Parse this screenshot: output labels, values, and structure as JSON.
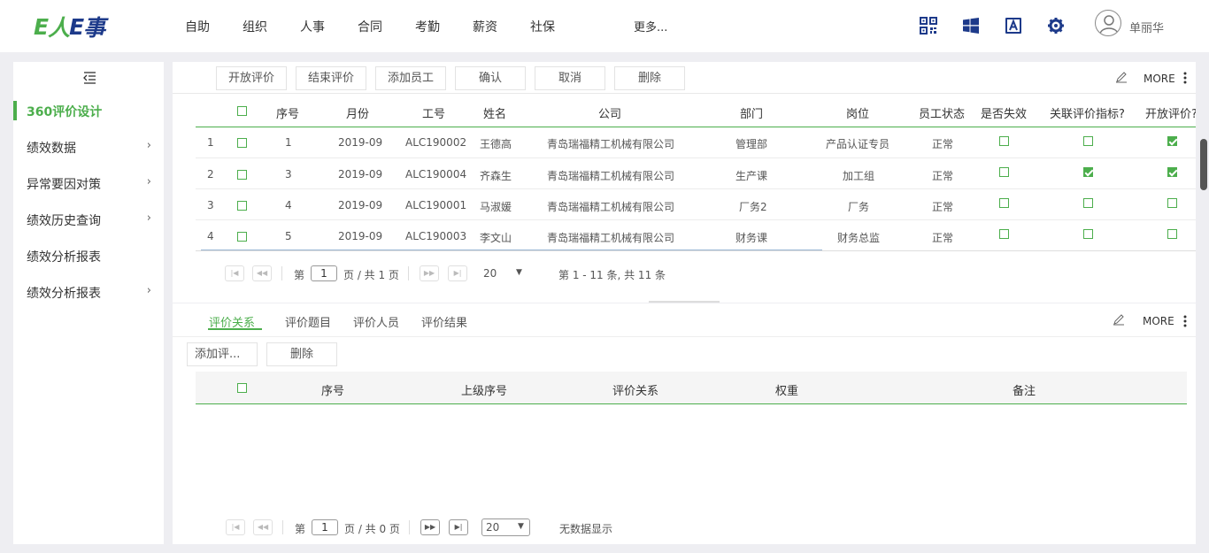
{
  "app": {
    "logo_parts": [
      "E",
      "人",
      "E",
      "事"
    ],
    "nav": [
      "自助",
      "组织",
      "人事",
      "合同",
      "考勤",
      "薪资",
      "社保"
    ],
    "nav_more": "更多...",
    "user_name": "单丽华"
  },
  "sidebar": {
    "items": [
      {
        "label": "360评价设计",
        "active": true,
        "has_children": false
      },
      {
        "label": "绩效数据",
        "active": false,
        "has_children": true
      },
      {
        "label": "异常要因对策",
        "active": false,
        "has_children": true
      },
      {
        "label": "绩效历史查询",
        "active": false,
        "has_children": true
      },
      {
        "label": "绩效分析报表",
        "active": false,
        "has_children": false
      },
      {
        "label": "绩效分析报表",
        "active": false,
        "has_children": true
      }
    ],
    "chevron": "›"
  },
  "toolbar": {
    "buttons": [
      "开放评价",
      "结束评价",
      "添加员工",
      "确认",
      "取消",
      "删除"
    ],
    "more": "MORE"
  },
  "grid": {
    "headers": [
      "序号",
      "月份",
      "工号",
      "姓名",
      "公司",
      "部门",
      "岗位",
      "员工状态",
      "是否失效",
      "关联评价指标?",
      "开放评价?"
    ],
    "rows": [
      {
        "n": "1",
        "seq": "1",
        "month": "2019-09",
        "id": "ALC190002",
        "name": "王德高",
        "company": "青岛瑞福精工机械有限公司",
        "dept": "管理部",
        "post": "产品认证专员",
        "status": "正常",
        "invalid": false,
        "linked": false,
        "open": true
      },
      {
        "n": "2",
        "seq": "3",
        "month": "2019-09",
        "id": "ALC190004",
        "name": "齐森生",
        "company": "青岛瑞福精工机械有限公司",
        "dept": "生产课",
        "post": "加工组",
        "status": "正常",
        "invalid": false,
        "linked": true,
        "open": true
      },
      {
        "n": "3",
        "seq": "4",
        "month": "2019-09",
        "id": "ALC190001",
        "name": "马淑媛",
        "company": "青岛瑞福精工机械有限公司",
        "dept": "厂务2",
        "post": "厂务",
        "status": "正常",
        "invalid": false,
        "linked": false,
        "open": false
      },
      {
        "n": "4",
        "seq": "5",
        "month": "2019-09",
        "id": "ALC190003",
        "name": "李文山",
        "company": "青岛瑞福精工机械有限公司",
        "dept": "财务课",
        "post": "财务总监",
        "status": "正常",
        "invalid": false,
        "linked": false,
        "open": false
      }
    ],
    "pager": {
      "first": "|◀",
      "prev": "◀◀",
      "next": "▶▶",
      "last": "▶|",
      "page_prefix": "第",
      "page": "1",
      "page_suffix": "页 / 共 1 页",
      "size": "20",
      "dropdown": "▼",
      "summary": "第 1 - 11 条, 共 11 条"
    }
  },
  "bottom": {
    "tabs": [
      "评价关系",
      "评价题目",
      "评价人员",
      "评价结果"
    ],
    "more": "MORE",
    "add_button": "添加评...",
    "delete_button": "删除",
    "headers": [
      "序号",
      "上级序号",
      "评价关系",
      "权重",
      "备注"
    ],
    "pager": {
      "first": "|◀",
      "prev": "◀◀",
      "next": "▶▶",
      "last": "▶|",
      "page_prefix": "第",
      "page": "1",
      "page_suffix": "页 / 共 0 页",
      "size": "20",
      "dropdown": "▼",
      "summary": "无数据显示"
    }
  },
  "colors": {
    "accent": "#4cae4c",
    "brand_blue": "#1d3a8a",
    "icon_blue": "#1d3a8a"
  }
}
